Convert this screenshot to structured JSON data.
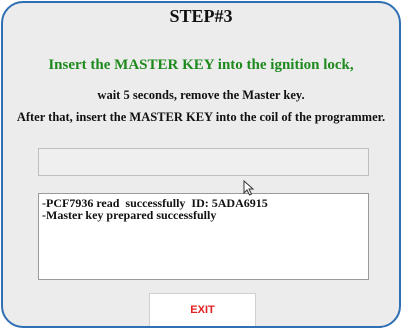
{
  "dialog": {
    "title": "STEP#3",
    "instruction_highlight": "Insert the MASTER KEY into the ignition lock,",
    "instruction_line_1": "wait 5 seconds, remove the Master key.",
    "instruction_line_2": "After that, insert the MASTER KEY into the coil of the programmer."
  },
  "progress_field": {
    "value": ""
  },
  "log": {
    "lines": [
      "-PCF7936 read  successfully  ID: 5ADA6915",
      "-Master key prepared successfully"
    ]
  },
  "buttons": {
    "exit_label": "EXIT"
  },
  "colors": {
    "border": "#2f6fb3",
    "highlight_text": "#1e8a1e",
    "exit_text": "#e02020",
    "background": "#ececec"
  },
  "icons": {
    "cursor": "mouse-pointer-icon"
  }
}
